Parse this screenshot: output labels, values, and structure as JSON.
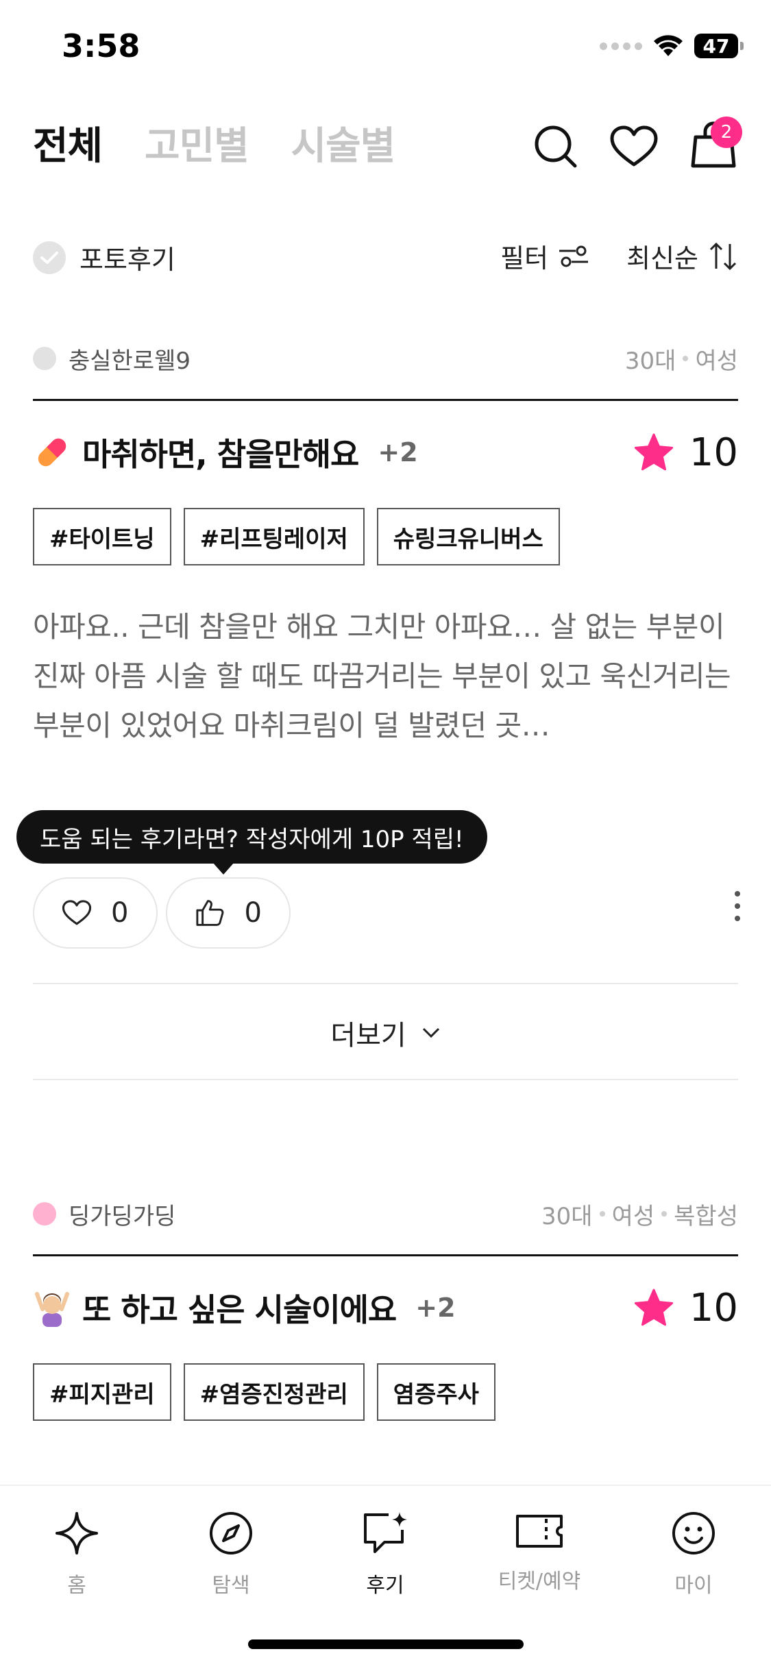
{
  "status_bar": {
    "time": "3:58",
    "battery": "47"
  },
  "tabs": [
    {
      "label": "전체",
      "active": true
    },
    {
      "label": "고민별",
      "active": false
    },
    {
      "label": "시술별",
      "active": false
    }
  ],
  "header": {
    "cart_badge": "2",
    "icons": [
      "search-icon",
      "heart-icon",
      "shopping-bag-icon"
    ]
  },
  "filters": {
    "photo_review_label": "포토후기",
    "filter_label": "필터",
    "sort_label": "최신순"
  },
  "reviews": [
    {
      "author": "충실한로웰9",
      "author_color": "#e2e2e2",
      "demographics": [
        "30대",
        "여성"
      ],
      "emoji": "pill-icon",
      "title": "마취하면, 참을만해요",
      "extra_count": "+2",
      "rating": "10",
      "tags": [
        "#타이트닝",
        "#리프팅레이저",
        "슈링크유니버스"
      ],
      "body": "아파요.. 근데 참을만 해요 그치만 아파요… 살 없는 부분이 진짜 아픔 시술 할 때도 따끔거리는 부분이 있고 욱신거리는 부분이 있었어요 마취크림이 덜 발렸던 곳…",
      "like_count": "0",
      "helpful_count": "0"
    },
    {
      "author": "딩가딩가딩",
      "author_color": "#ffb1cf",
      "demographics": [
        "30대",
        "여성",
        "복합성"
      ],
      "emoji": "person-ok-gesture-icon",
      "title": "또 하고 싶은 시술이에요",
      "extra_count": "+2",
      "rating": "10",
      "tags": [
        "#피지관리",
        "#염증진정관리",
        "염증주사"
      ]
    }
  ],
  "tooltip": "도움 되는 후기라면? 작성자에게 10P 적립!",
  "see_more": "더보기",
  "nav": [
    {
      "label": "홈",
      "icon": "sparkle-icon",
      "active": false
    },
    {
      "label": "탐색",
      "icon": "compass-icon",
      "active": false
    },
    {
      "label": "후기",
      "icon": "review-chat-icon",
      "active": true
    },
    {
      "label": "티켓/예약",
      "icon": "ticket-icon",
      "active": false
    },
    {
      "label": "마이",
      "icon": "smiley-icon",
      "active": false
    }
  ],
  "colors": {
    "accent_pink": "#ff2d8a",
    "star": "#ff2d8a"
  }
}
